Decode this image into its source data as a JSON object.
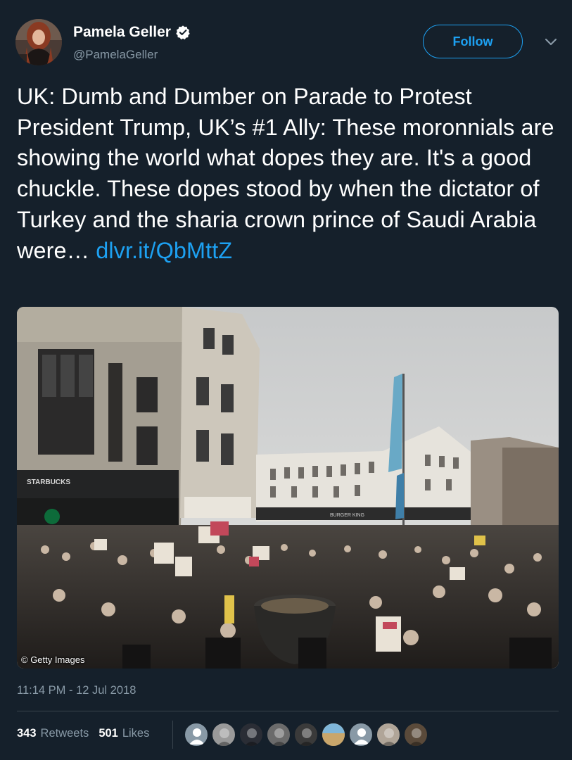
{
  "user": {
    "name": "Pamela Geller",
    "handle": "@PamelaGeller",
    "verified": true,
    "avatar_icon": "profile-photo"
  },
  "follow_label": "Follow",
  "tweet": {
    "text": "UK: Dumb and Dumber on Parade to Protest President Trump, UK’s #1 Ally: These moronnials are showing the world what dopes they are. It's a good chuckle. These dopes stood by when the dictator of Turkey and the sharia crown prince of Saudi Arabia were… ",
    "link": "dlvr.it/QbMttZ"
  },
  "photo": {
    "credit": "© Getty Images",
    "storefront_sign": "STARBUCKS",
    "shop_sign": "BURGER KING"
  },
  "timestamp": "11:14 PM - 12 Jul 2018",
  "stats": {
    "retweets_count": "343",
    "retweets_label": "Retweets",
    "likes_count": "501",
    "likes_label": "Likes"
  },
  "likers": [
    {
      "icon": "default-avatar",
      "color": "#8899a6"
    },
    {
      "icon": "portrait-avatar",
      "color": "#9a9a9a"
    },
    {
      "icon": "dark-avatar",
      "color": "#2a2d35"
    },
    {
      "icon": "portrait-avatar",
      "color": "#6b6b6b"
    },
    {
      "icon": "bw-avatar",
      "color": "#3a3a3a"
    },
    {
      "icon": "landscape-avatar",
      "color": "#c9a66b"
    },
    {
      "icon": "default-avatar",
      "color": "#8899a6"
    },
    {
      "icon": "portrait-avatar",
      "color": "#b0a598"
    },
    {
      "icon": "portrait-avatar",
      "color": "#5a4a3a"
    }
  ],
  "colors": {
    "background": "#15202b",
    "accent": "#1da1f2",
    "secondary_text": "#8899a6",
    "divider": "#38444d"
  }
}
